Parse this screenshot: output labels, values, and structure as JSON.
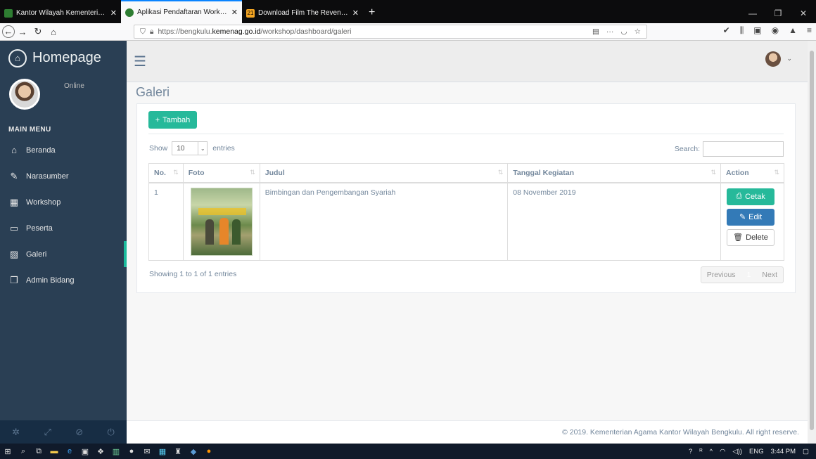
{
  "browser": {
    "tabs": [
      {
        "title": "Kantor Wilayah Kementerian Agam",
        "active": false,
        "favicon_color": "#2e7d32"
      },
      {
        "title": "Aplikasi Pendaftaran Workshop",
        "active": true,
        "favicon_color": "#2e7d32"
      },
      {
        "title": "Download Film The Revenant",
        "active": false,
        "favicon_color": "#f5a623",
        "badge": "21"
      }
    ],
    "url_prefix": "https://bengkulu.",
    "url_domain": "kemenag.go.id",
    "url_path": "/workshop/dashboard/galeri",
    "new_tab": "+"
  },
  "sidebar": {
    "brand": "Homepage",
    "status": "Online",
    "menu_heading": "MAIN MENU",
    "items": [
      {
        "label": "Beranda",
        "icon": "home-icon",
        "glyph": "⌂"
      },
      {
        "label": "Narasumber",
        "icon": "edit-icon",
        "glyph": "✎"
      },
      {
        "label": "Workshop",
        "icon": "table-icon",
        "glyph": "▦"
      },
      {
        "label": "Peserta",
        "icon": "desktop-icon",
        "glyph": "▭"
      },
      {
        "label": "Galeri",
        "icon": "image-icon",
        "glyph": "▨"
      },
      {
        "label": "Admin Bidang",
        "icon": "copy-icon",
        "glyph": "❐"
      }
    ],
    "active_item": "Galeri"
  },
  "page": {
    "title": "Galeri",
    "add_button": "Tambah",
    "show_label": "Show",
    "entries_value": "10",
    "entries_label": "entries",
    "search_label": "Search:",
    "columns": [
      "No.",
      "Foto",
      "Judul",
      "Tanggal Kegiatan",
      "Action"
    ],
    "rows": [
      {
        "no": "1",
        "judul": "Bimbingan dan Pengembangan Syariah",
        "tanggal": "08 November 2019"
      }
    ],
    "actions": {
      "cetak": "Cetak",
      "edit": "Edit",
      "delete": "Delete"
    },
    "info": "Showing 1 to 1 of 1 entries",
    "pager": {
      "previous": "Previous",
      "current": "1",
      "next": "Next"
    },
    "footer": "© 2019. Kementerian Agama Kantor Wilayah Bengkulu. All right reserve."
  },
  "taskbar": {
    "lang": "ENG",
    "time": "3:44 PM"
  },
  "colors": {
    "sidebar_bg": "#2a3f54",
    "accent_green": "#26b99a",
    "accent_blue": "#337ab7"
  }
}
